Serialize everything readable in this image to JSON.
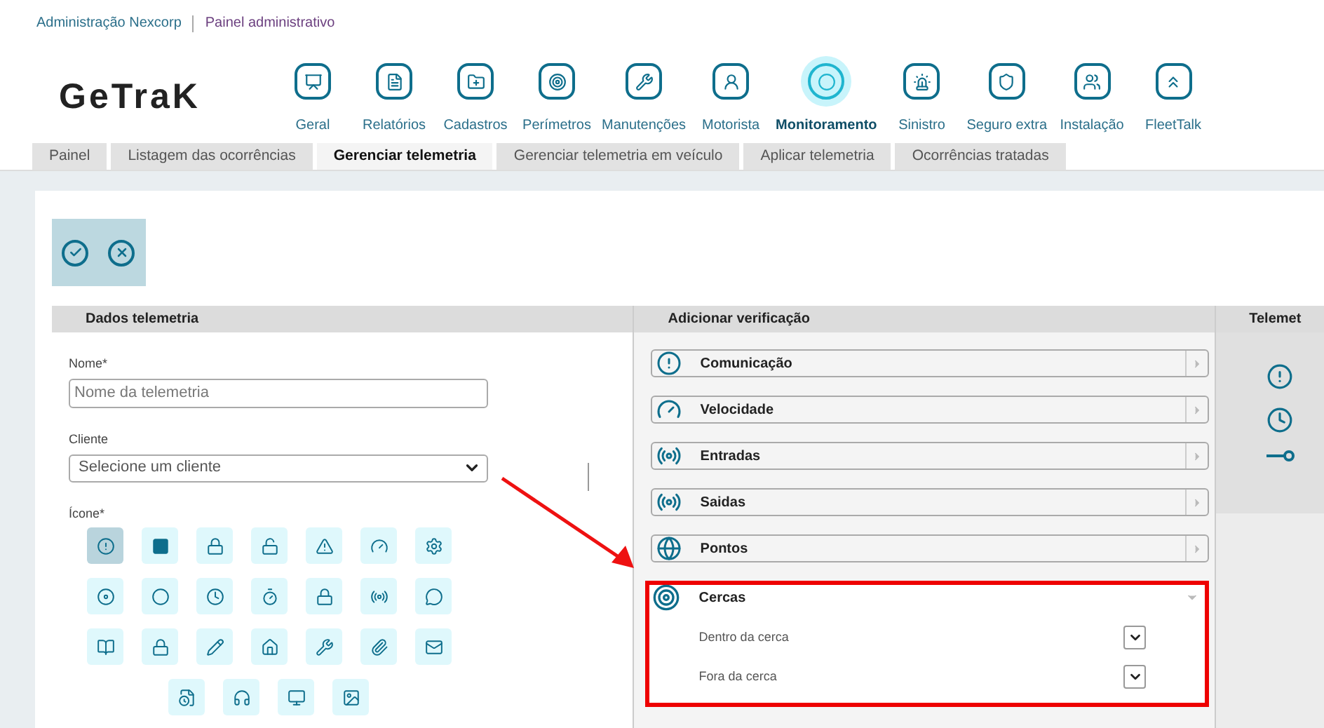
{
  "breadcrumb": [
    "Administração Nexcorp",
    "Painel administrativo"
  ],
  "logo": "GeTraK",
  "nav": [
    {
      "label": "Geral",
      "selected": false
    },
    {
      "label": "Relatórios",
      "selected": false
    },
    {
      "label": "Cadastros",
      "selected": false
    },
    {
      "label": "Perímetros",
      "selected": false
    },
    {
      "label": "Manutenções",
      "selected": false
    },
    {
      "label": "Motorista",
      "selected": false
    },
    {
      "label": "Monitoramento",
      "selected": true
    },
    {
      "label": "Sinistro",
      "selected": false
    },
    {
      "label": "Seguro extra",
      "selected": false
    },
    {
      "label": "Instalação",
      "selected": false
    },
    {
      "label": "FleetTalk",
      "selected": false
    }
  ],
  "tabs": [
    {
      "label": "Painel",
      "selected": false
    },
    {
      "label": "Listagem das ocorrências",
      "selected": false
    },
    {
      "label": "Gerenciar telemetria",
      "selected": true
    },
    {
      "label": "Gerenciar telemetria em veículo",
      "selected": false
    },
    {
      "label": "Aplicar telemetria",
      "selected": false
    },
    {
      "label": "Ocorrências tratadas",
      "selected": false
    }
  ],
  "dados": {
    "title": "Dados telemetria",
    "nome": {
      "label": "Nome*",
      "placeholder": "Nome da telemetria"
    },
    "cliente": {
      "label": "Cliente",
      "value": "Selecione um cliente"
    },
    "icone_label": "Ícone*",
    "icons": [
      {
        "selected": true
      },
      {
        "selected": false
      },
      {
        "selected": false
      },
      {
        "selected": false
      },
      {
        "selected": false
      },
      {
        "selected": false
      },
      {
        "selected": false
      },
      {
        "selected": false
      },
      {
        "selected": false
      },
      {
        "selected": false
      },
      {
        "selected": false
      },
      {
        "selected": false
      },
      {
        "selected": false
      },
      {
        "selected": false
      },
      {
        "selected": false
      },
      {
        "selected": false
      },
      {
        "selected": false
      },
      {
        "selected": false
      },
      {
        "selected": false
      },
      {
        "selected": false
      },
      {
        "selected": false
      },
      {
        "selected": false
      },
      {
        "selected": false
      },
      {
        "selected": false
      },
      {
        "selected": false
      }
    ]
  },
  "verificacao": {
    "title": "Adicionar verificação",
    "items": [
      {
        "label": "Comunicação",
        "expanded": false
      },
      {
        "label": "Velocidade",
        "expanded": false
      },
      {
        "label": "Entradas",
        "expanded": false
      },
      {
        "label": "Saidas",
        "expanded": false
      },
      {
        "label": "Pontos",
        "expanded": false
      },
      {
        "label": "Cercas",
        "expanded": true,
        "options": [
          "Dentro da cerca",
          "Fora da cerca"
        ]
      }
    ]
  },
  "telemetria": {
    "title": "Telemet"
  }
}
